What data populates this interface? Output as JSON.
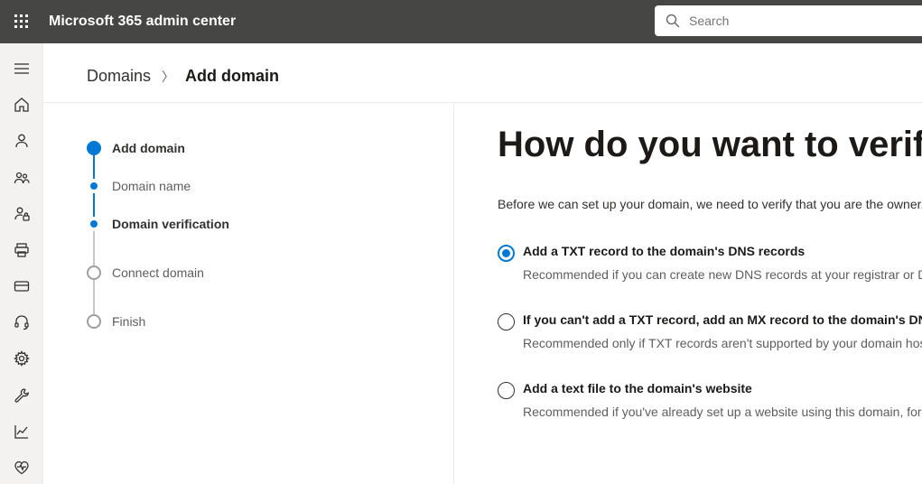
{
  "header": {
    "title": "Microsoft 365 admin center",
    "search_placeholder": "Search"
  },
  "breadcrumb": {
    "parent": "Domains",
    "current": "Add domain"
  },
  "steps": [
    {
      "label": "Add domain",
      "state": "current"
    },
    {
      "label": "Domain name",
      "state": "sub"
    },
    {
      "label": "Domain verification",
      "state": "sub-active"
    },
    {
      "label": "Connect domain",
      "state": "pending"
    },
    {
      "label": "Finish",
      "state": "pending"
    }
  ],
  "main": {
    "heading": "How do you want to verify your domain?",
    "intro": "Before we can set up your domain, we need to verify that you are the owner.",
    "options": [
      {
        "title": "Add a TXT record to the domain's DNS records",
        "desc": "Recommended if you can create new DNS records at your registrar or DNS host.",
        "selected": true
      },
      {
        "title": "If you can't add a TXT record, add an MX record to the domain's DNS records",
        "desc": "Recommended only if TXT records aren't supported by your domain host.",
        "selected": false
      },
      {
        "title": "Add a text file to the domain's website",
        "desc": "Recommended if you've already set up a website using this domain, for example www.contoso.com.",
        "selected": false
      }
    ]
  }
}
